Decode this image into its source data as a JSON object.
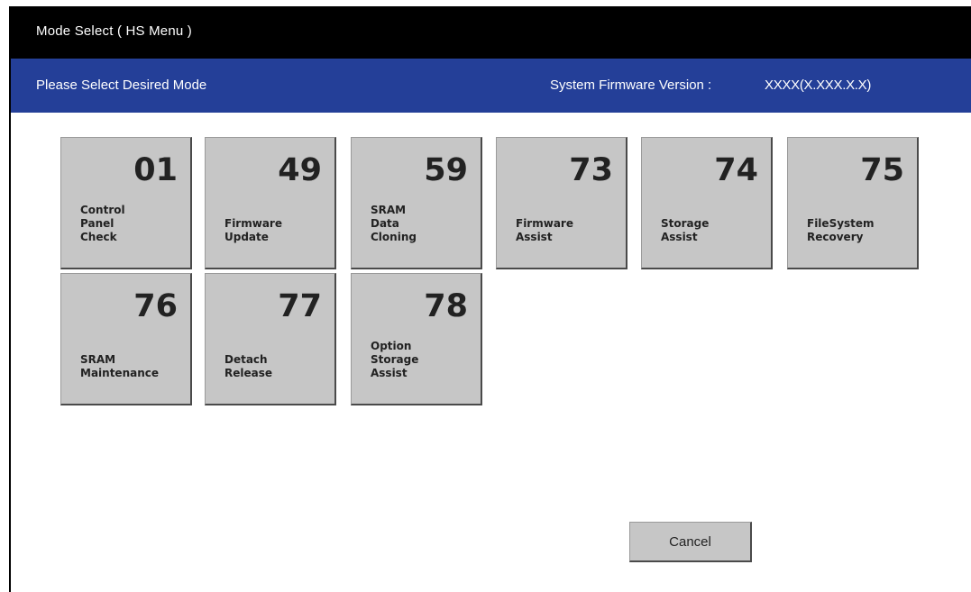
{
  "window": {
    "title": "Mode Select ( HS Menu )"
  },
  "info_bar": {
    "prompt": "Please Select Desired Mode",
    "firmware_label": "System Firmware Version :",
    "firmware_value": "XXXX(X.XXX.X.X)"
  },
  "modes": [
    {
      "number": "01",
      "label": "Control\nPanel\nCheck"
    },
    {
      "number": "49",
      "label": "Firmware\nUpdate"
    },
    {
      "number": "59",
      "label": "SRAM\nData\nCloning"
    },
    {
      "number": "73",
      "label": "Firmware\nAssist"
    },
    {
      "number": "74",
      "label": "Storage\nAssist"
    },
    {
      "number": "75",
      "label": "FileSystem\nRecovery"
    },
    {
      "number": "76",
      "label": "SRAM\nMaintenance"
    },
    {
      "number": "77",
      "label": "Detach\nRelease"
    },
    {
      "number": "78",
      "label": "Option\nStorage\nAssist"
    }
  ],
  "cancel_label": "Cancel",
  "colors": {
    "titlebar": "#000000",
    "infobar": "#243f98",
    "tile": "#c6c6c6"
  }
}
